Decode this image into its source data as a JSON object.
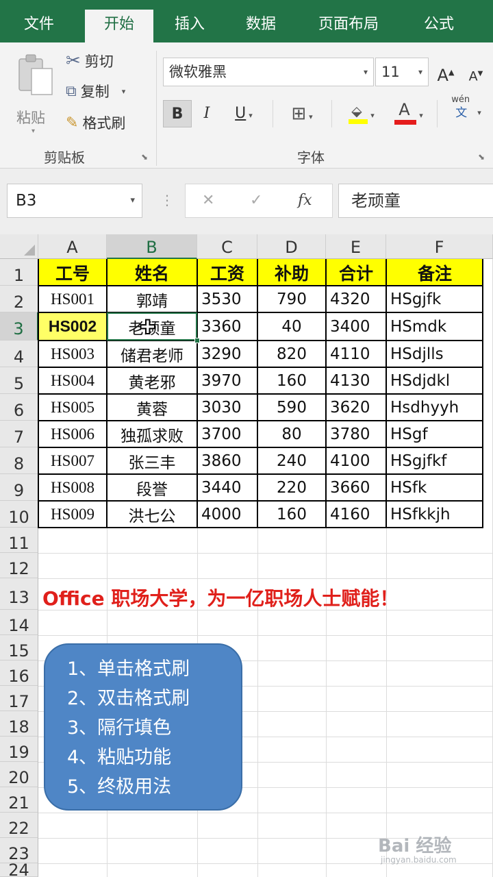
{
  "tabs": [
    "文件",
    "开始",
    "插入",
    "数据",
    "页面布局",
    "公式"
  ],
  "active_tab": 1,
  "clipboard": {
    "paste": "粘贴",
    "cut": "剪切",
    "copy": "复制",
    "format_painter": "格式刷",
    "group_label": "剪贴板"
  },
  "font": {
    "name": "微软雅黑",
    "size": "11",
    "grow": "A",
    "shrink": "A",
    "bold": "B",
    "italic": "I",
    "underline": "U",
    "group_label": "字体",
    "phonetic_top": "wén",
    "phonetic_bottom": "文"
  },
  "formula_bar": {
    "name_box": "B3",
    "content": "老顽童",
    "fx": "fx"
  },
  "columns": [
    "A",
    "B",
    "C",
    "D",
    "E",
    "F"
  ],
  "rows": [
    "1",
    "2",
    "3",
    "4",
    "5",
    "6",
    "7",
    "8",
    "9",
    "10",
    "11",
    "12",
    "13",
    "14",
    "15",
    "16",
    "17",
    "18",
    "19",
    "20",
    "21",
    "22",
    "23",
    "24"
  ],
  "table": {
    "headers": [
      "工号",
      "姓名",
      "工资",
      "补助",
      "合计",
      "备注"
    ],
    "rows": [
      [
        "HS001",
        "郭靖",
        "3530",
        "790",
        "4320",
        "HSgjfk"
      ],
      [
        "HS002",
        "老顽童",
        "3360",
        "40",
        "3400",
        "HSmdk"
      ],
      [
        "HS003",
        "储君老师",
        "3290",
        "820",
        "4110",
        "HSdjlls"
      ],
      [
        "HS004",
        "黄老邪",
        "3970",
        "160",
        "4130",
        "HSdjdkl"
      ],
      [
        "HS005",
        "黄蓉",
        "3030",
        "590",
        "3620",
        "Hsdhyyh"
      ],
      [
        "HS006",
        "独孤求败",
        "3700",
        "80",
        "3780",
        "HSgf"
      ],
      [
        "HS007",
        "张三丰",
        "3860",
        "240",
        "4100",
        "HSgjfkf"
      ],
      [
        "HS008",
        "段誉",
        "3440",
        "220",
        "3660",
        "HSfk"
      ],
      [
        "HS009",
        "洪七公",
        "4000",
        "160",
        "4160",
        "HSfkkjh"
      ]
    ]
  },
  "slogan": "Office 职场大学，为一亿职场人士赋能！",
  "bubble_items": [
    "1、单击格式刷",
    "2、双击格式刷",
    "3、隔行填色",
    "4、粘贴功能",
    "5、终极用法"
  ],
  "watermark": "Bai 经验",
  "watermark_sub": "jingyan.baidu.com",
  "colors": {
    "ribbon_green": "#227447",
    "header_fill": "#ffff00",
    "slogan_red": "#e0201b",
    "bubble_blue": "#4f86c6"
  }
}
